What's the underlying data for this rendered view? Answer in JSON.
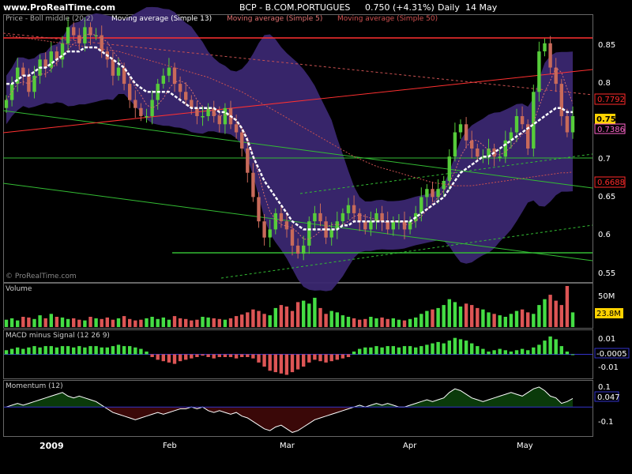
{
  "header": {
    "site": "www.ProRealTime.com",
    "title": "BCP - B.COM.PORTUGUES",
    "quote": "0.750 (+4.31%)",
    "period": "Daily",
    "date": "14 May"
  },
  "watermark": "© ProRealTime.com",
  "colors": {
    "background": "#000000",
    "bollinger_band": "#3a2770",
    "candle_up": "#56cc3a",
    "candle_down": "#c86a5a",
    "sma13": "#ffffff",
    "sma5": "#d87070",
    "sma50": "#c85050",
    "resistance": "#ff3030",
    "trend_green": "#33bb33",
    "volume_up": "#44dd44",
    "volume_down": "#dd5555",
    "momentum_pos": "#0a3a0a",
    "momentum_neg": "#3a0808",
    "zero_line": "#3333cc"
  },
  "chart_data": [
    {
      "type": "candlestick",
      "panel": "price",
      "legend": [
        "Price - Boll middle (20,2)",
        "Moving average (Simple 13)",
        "Moving average (Simple 5)",
        "Moving average (Simple 50)"
      ],
      "ylim": [
        0.545,
        0.875
      ],
      "y_ticks": [
        "0.85",
        "0.8",
        "0.75",
        "0.7",
        "0.65",
        "0.6",
        "0.55"
      ],
      "x_labels": [
        "2009",
        "Feb",
        "Mar",
        "Apr",
        "May"
      ],
      "price_labels": [
        {
          "value": "0.7792",
          "color": "#ff2a2a"
        },
        {
          "value": "0.750",
          "color": "#ffd200"
        },
        {
          "value": "0.7386",
          "color": "#ff66cc"
        },
        {
          "value": "0.6688",
          "color": "#ff2a2a"
        }
      ],
      "close": [
        0.77,
        0.79,
        0.81,
        0.8,
        0.78,
        0.8,
        0.82,
        0.81,
        0.83,
        0.82,
        0.84,
        0.86,
        0.85,
        0.84,
        0.86,
        0.85,
        0.85,
        0.83,
        0.82,
        0.8,
        0.81,
        0.79,
        0.77,
        0.76,
        0.75,
        0.75,
        0.77,
        0.79,
        0.8,
        0.81,
        0.79,
        0.78,
        0.77,
        0.76,
        0.75,
        0.75,
        0.76,
        0.75,
        0.74,
        0.76,
        0.74,
        0.73,
        0.71,
        0.68,
        0.65,
        0.62,
        0.6,
        0.61,
        0.63,
        0.62,
        0.61,
        0.59,
        0.58,
        0.59,
        0.62,
        0.63,
        0.62,
        0.6,
        0.61,
        0.62,
        0.63,
        0.64,
        0.63,
        0.62,
        0.61,
        0.62,
        0.63,
        0.62,
        0.61,
        0.62,
        0.62,
        0.61,
        0.62,
        0.63,
        0.65,
        0.66,
        0.65,
        0.66,
        0.67,
        0.7,
        0.73,
        0.74,
        0.72,
        0.71,
        0.7,
        0.7,
        0.71,
        0.7,
        0.7,
        0.72,
        0.73,
        0.75,
        0.74,
        0.71,
        0.78,
        0.83,
        0.84,
        0.81,
        0.79,
        0.75,
        0.73,
        0.75
      ],
      "series": [
        {
          "name": "Moving average (Simple 13)",
          "values": [
            0.79,
            0.79,
            0.795,
            0.8,
            0.8,
            0.805,
            0.81,
            0.81,
            0.815,
            0.82,
            0.825,
            0.83,
            0.83,
            0.83,
            0.835,
            0.835,
            0.835,
            0.83,
            0.825,
            0.82,
            0.815,
            0.81,
            0.8,
            0.79,
            0.785,
            0.78,
            0.78,
            0.78,
            0.78,
            0.78,
            0.775,
            0.77,
            0.765,
            0.76,
            0.76,
            0.76,
            0.76,
            0.76,
            0.755,
            0.755,
            0.75,
            0.745,
            0.735,
            0.72,
            0.7,
            0.685,
            0.67,
            0.66,
            0.65,
            0.64,
            0.63,
            0.62,
            0.615,
            0.61,
            0.61,
            0.61,
            0.61,
            0.61,
            0.61,
            0.61,
            0.615,
            0.615,
            0.62,
            0.62,
            0.62,
            0.62,
            0.62,
            0.62,
            0.62,
            0.62,
            0.62,
            0.62,
            0.62,
            0.625,
            0.63,
            0.635,
            0.64,
            0.645,
            0.65,
            0.66,
            0.67,
            0.68,
            0.685,
            0.69,
            0.695,
            0.7,
            0.7,
            0.705,
            0.71,
            0.715,
            0.72,
            0.725,
            0.73,
            0.735,
            0.74,
            0.745,
            0.75,
            0.755,
            0.76,
            0.76,
            0.755,
            0.755
          ]
        },
        {
          "name": "Moving average (Simple 50)",
          "values": [
            0.85,
            0.849,
            0.848,
            0.847,
            0.846,
            0.845,
            0.844,
            0.843,
            0.842,
            0.841,
            0.84,
            0.839,
            0.838,
            0.837,
            0.836,
            0.835,
            0.834,
            0.833,
            0.832,
            0.831,
            0.83,
            0.828,
            0.826,
            0.824,
            0.822,
            0.82,
            0.818,
            0.816,
            0.814,
            0.812,
            0.81,
            0.808,
            0.806,
            0.804,
            0.802,
            0.8,
            0.798,
            0.795,
            0.792,
            0.789,
            0.786,
            0.783,
            0.78,
            0.776,
            0.772,
            0.768,
            0.764,
            0.76,
            0.756,
            0.752,
            0.748,
            0.744,
            0.74,
            0.736,
            0.732,
            0.728,
            0.724,
            0.72,
            0.716,
            0.712,
            0.708,
            0.704,
            0.7,
            0.697,
            0.694,
            0.691,
            0.688,
            0.686,
            0.684,
            0.682,
            0.68,
            0.678,
            0.676,
            0.674,
            0.672,
            0.67,
            0.668,
            0.667,
            0.666,
            0.665,
            0.664,
            0.664,
            0.664,
            0.664,
            0.665,
            0.666,
            0.667,
            0.668,
            0.669,
            0.67,
            0.671,
            0.672,
            0.673,
            0.674,
            0.675,
            0.676,
            0.677,
            0.678,
            0.679,
            0.68,
            0.68,
            0.681
          ]
        }
      ]
    },
    {
      "type": "bar",
      "panel": "volume",
      "legend": "Volume",
      "y_ticks": [
        "50M"
      ],
      "current_label": "23.8M",
      "values": [
        10,
        12,
        9,
        14,
        13,
        11,
        16,
        12,
        18,
        14,
        13,
        11,
        12,
        10,
        9,
        14,
        12,
        11,
        13,
        10,
        12,
        15,
        11,
        9,
        10,
        12,
        14,
        11,
        13,
        10,
        15,
        12,
        11,
        9,
        10,
        14,
        13,
        12,
        11,
        10,
        12,
        15,
        17,
        20,
        24,
        22,
        18,
        16,
        26,
        30,
        28,
        22,
        34,
        36,
        32,
        40,
        26,
        18,
        22,
        20,
        16,
        14,
        12,
        10,
        11,
        14,
        12,
        13,
        11,
        12,
        10,
        9,
        11,
        13,
        18,
        22,
        24,
        26,
        30,
        38,
        34,
        28,
        32,
        30,
        26,
        24,
        20,
        18,
        16,
        14,
        18,
        22,
        24,
        20,
        18,
        30,
        38,
        44,
        36,
        30,
        56,
        20
      ]
    },
    {
      "type": "bar",
      "panel": "macd",
      "legend": "MACD minus Signal (12 26 9)",
      "y_ticks": [
        "0.01",
        "-0.01"
      ],
      "current_label": "-0.0005",
      "ylim": [
        -0.017,
        0.017
      ],
      "values": [
        0.003,
        0.004,
        0.005,
        0.004,
        0.005,
        0.006,
        0.005,
        0.006,
        0.006,
        0.005,
        0.006,
        0.006,
        0.005,
        0.006,
        0.005,
        0.006,
        0.006,
        0.005,
        0.005,
        0.006,
        0.007,
        0.006,
        0.006,
        0.005,
        0.004,
        0.002,
        -0.002,
        -0.004,
        -0.005,
        -0.006,
        -0.007,
        -0.005,
        -0.004,
        -0.003,
        -0.002,
        -0.001,
        -0.002,
        -0.003,
        -0.002,
        -0.002,
        -0.002,
        -0.003,
        -0.002,
        -0.002,
        -0.003,
        -0.006,
        -0.009,
        -0.012,
        -0.013,
        -0.014,
        -0.015,
        -0.013,
        -0.011,
        -0.009,
        -0.006,
        -0.004,
        -0.005,
        -0.006,
        -0.005,
        -0.004,
        -0.003,
        -0.002,
        0.002,
        0.004,
        0.005,
        0.005,
        0.006,
        0.005,
        0.006,
        0.006,
        0.005,
        0.006,
        0.006,
        0.005,
        0.006,
        0.007,
        0.008,
        0.009,
        0.008,
        0.01,
        0.012,
        0.011,
        0.01,
        0.008,
        0.006,
        0.004,
        0.002,
        0.003,
        0.004,
        0.003,
        0.002,
        0.003,
        0.004,
        0.003,
        0.005,
        0.007,
        0.01,
        0.013,
        0.011,
        0.006,
        0.002,
        0.0
      ]
    },
    {
      "type": "area",
      "panel": "momentum",
      "legend": "Momentum (12)",
      "y_ticks": [
        "0.1",
        "-0.1"
      ],
      "current_label": "0.047",
      "ylim": [
        -0.16,
        0.14
      ],
      "values": [
        0.0,
        0.01,
        0.02,
        0.01,
        0.02,
        0.03,
        0.04,
        0.05,
        0.06,
        0.07,
        0.08,
        0.06,
        0.05,
        0.06,
        0.05,
        0.04,
        0.03,
        0.01,
        -0.01,
        -0.03,
        -0.04,
        -0.05,
        -0.06,
        -0.07,
        -0.06,
        -0.05,
        -0.04,
        -0.03,
        -0.04,
        -0.03,
        -0.02,
        -0.01,
        -0.01,
        0.0,
        -0.01,
        0.0,
        -0.02,
        -0.03,
        -0.02,
        -0.03,
        -0.04,
        -0.03,
        -0.05,
        -0.06,
        -0.08,
        -0.1,
        -0.12,
        -0.13,
        -0.11,
        -0.1,
        -0.12,
        -0.14,
        -0.13,
        -0.11,
        -0.09,
        -0.07,
        -0.06,
        -0.05,
        -0.04,
        -0.03,
        -0.02,
        -0.01,
        0.0,
        0.01,
        0.0,
        0.01,
        0.02,
        0.01,
        0.02,
        0.01,
        0.0,
        0.0,
        0.01,
        0.02,
        0.03,
        0.04,
        0.03,
        0.04,
        0.05,
        0.08,
        0.1,
        0.09,
        0.07,
        0.05,
        0.04,
        0.03,
        0.04,
        0.05,
        0.06,
        0.07,
        0.08,
        0.07,
        0.06,
        0.08,
        0.1,
        0.11,
        0.09,
        0.06,
        0.05,
        0.02,
        0.03,
        0.047
      ]
    }
  ]
}
